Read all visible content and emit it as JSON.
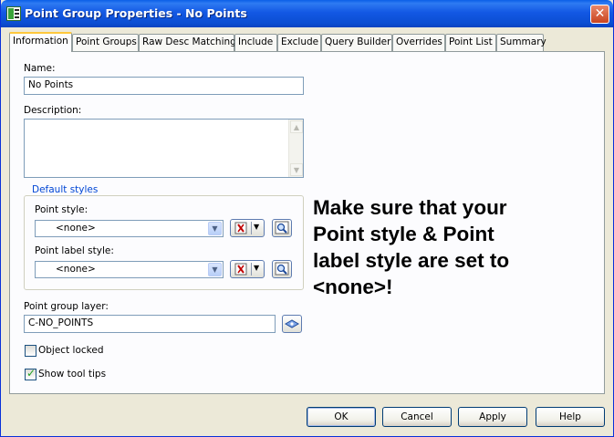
{
  "window": {
    "title": "Point Group Properties - No Points"
  },
  "tabs": [
    {
      "label": "Information",
      "active": true
    },
    {
      "label": "Point Groups"
    },
    {
      "label": "Raw Desc Matching"
    },
    {
      "label": "Include"
    },
    {
      "label": "Exclude"
    },
    {
      "label": "Query Builder"
    },
    {
      "label": "Overrides"
    },
    {
      "label": "Point List"
    },
    {
      "label": "Summary"
    }
  ],
  "information": {
    "name_label": "Name:",
    "name_value": "No Points",
    "description_label": "Description:",
    "description_value": "",
    "default_styles": {
      "title": "Default styles",
      "point_style_label": "Point style:",
      "point_style_value": "<none>",
      "point_label_style_label": "Point label style:",
      "point_label_style_value": "<none>"
    },
    "layer_label": "Point group layer:",
    "layer_value": "C-NO_POINTS",
    "object_locked_label": "Object locked",
    "object_locked": false,
    "show_tool_tips_label": "Show tool tips",
    "show_tool_tips": true
  },
  "annotation": "Make sure that your\nPoint style & Point\nlabel style are set to\n<none>!",
  "buttons": {
    "ok": "OK",
    "cancel": "Cancel",
    "apply": "Apply",
    "help": "Help"
  },
  "colors": {
    "titlebar": "#0B4ED2",
    "close": "#C9441F",
    "group_title": "#0046D5",
    "active_tab_accent": "#FFC83C",
    "checkmark": "#21A121"
  },
  "icons": [
    "application-icon",
    "close-icon",
    "style-edit-icon",
    "preview-magnifier-icon",
    "layer-picker-icon",
    "checkmark-icon"
  ]
}
